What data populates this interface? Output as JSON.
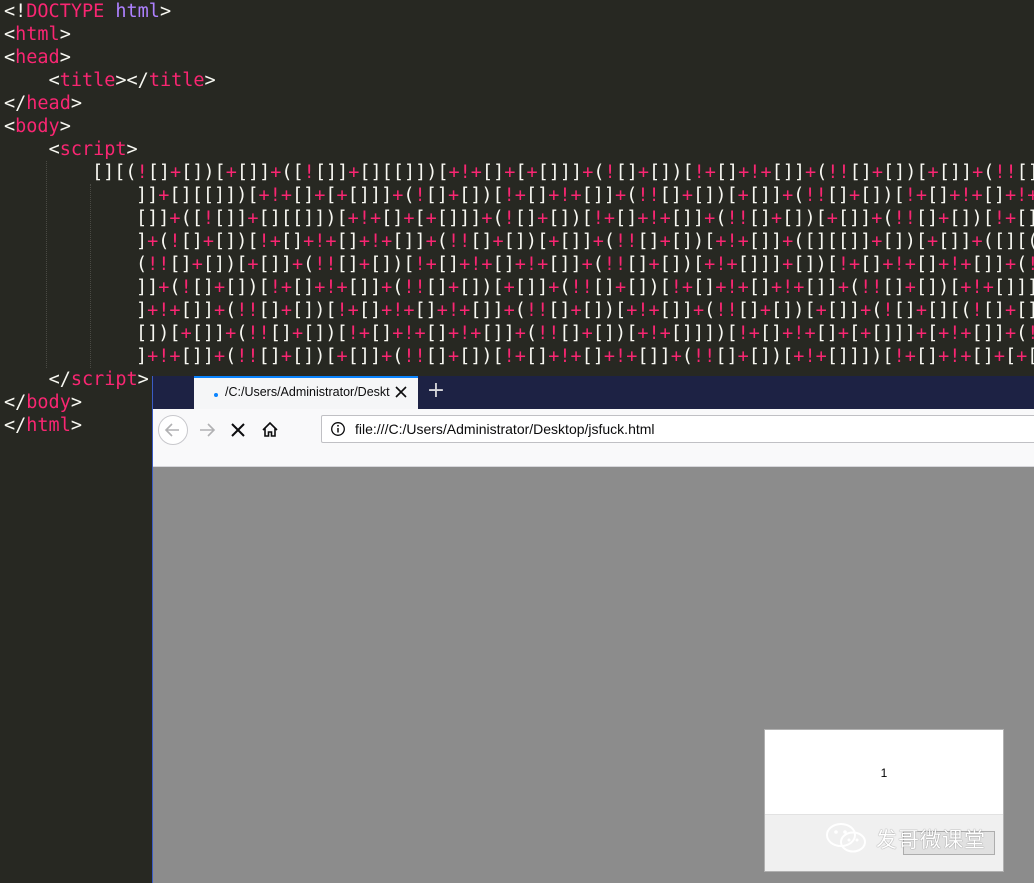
{
  "editor": {
    "lines": [
      {
        "open": "<!",
        "tag": "DOCTYPE",
        "attr": "html",
        "close": ">"
      },
      {
        "open": "<",
        "tag": "html",
        "close": ">"
      },
      {
        "open": "<",
        "tag": "head",
        "close": ">"
      },
      {
        "indent": "    ",
        "open": "<",
        "tag": "title",
        "mid": "></",
        "tag2": "title",
        "close": ">"
      },
      {
        "open": "</",
        "tag": "head",
        "close": ">"
      },
      {
        "open": "<",
        "tag": "body",
        "close": ">"
      },
      {
        "indent": "    ",
        "open": "<",
        "tag": "script",
        "close": ">"
      },
      {
        "indent": "    ",
        "open": "</",
        "tag": "script",
        "close": ">"
      },
      {
        "open": "</",
        "tag": "body",
        "close": ">"
      },
      {
        "open": "</",
        "tag": "html",
        "close": ">"
      }
    ],
    "script_lines": [
      "[][(![]+[])[+[]]+([![]]+[][[]])[+!+[]+[+[]]]+(![]+[])[!+[]+!+[]]+(!![]+[])[+[]]+(!![]+",
      "]]+[][[]])[+!+[]+[+[]]]+(![]+[])[!+[]+!+[]]+(!![]+[])[+[]]+(!![]+[])[!+[]+!+[]+!+[",
      "[]]+([![]]+[][[]])[+!+[]+[+[]]]+(![]+[])[!+[]+!+[]]+(!![]+[])[+[]]+(!![]+[])[!+[]",
      "]+(![]+[])[!+[]+!+[]+!+[]]+(!![]+[])[+[]]+(!![]+[])[+!+[]]+([][[]]+[])[+[]]+([][(",
      "(!![]+[])[+[]]+(!![]+[])[!+[]+!+[]+!+[]]+(!![]+[])[+!+[]]]+[])[!+[]+!+[]+!+[]]+(!!",
      "]]+(![]+[])[!+[]+!+[]]+(!![]+[])[+[]]+(!![]+[])[!+[]+!+[]+!+[]]+(!![]+[])[+!+[]]])",
      "]+!+[]]+(!![]+[])[!+[]+!+[]+!+[]]+(!![]+[])[+!+[]]+(!![]+[])[+[]]+(![]+[][(![]+[])",
      "[])[+[]]+(!![]+[])[!+[]+!+[]+!+[]]+(!![]+[])[+!+[]]])[!+[]+!+[]+[+[]]]+[+!+[]]+(!!",
      "]+!+[]]+(!![]+[])[+[]]+(!![]+[])[!+[]+!+[]+!+[]]+(!![]+[])[+!+[]]])[!+[]+!+[]+[+[]"
    ]
  },
  "browser": {
    "tab_title": "/C:/Users/Administrator/Desktop/jsfuck.html",
    "new_tab_label": "+",
    "url": "file:///C:/Users/Administrator/Desktop/jsfuck.html"
  },
  "dialog": {
    "message": "1",
    "ok_label": ""
  },
  "watermark": {
    "text": "发哥微课堂"
  },
  "colors": {
    "editor_bg": "#272822",
    "tag": "#f92672",
    "attr": "#ae81ff",
    "text": "#f8f8f2",
    "tab_bar": "#1d2244",
    "tab_accent": "#0a84ff",
    "page_bg": "#8c8c8c"
  }
}
